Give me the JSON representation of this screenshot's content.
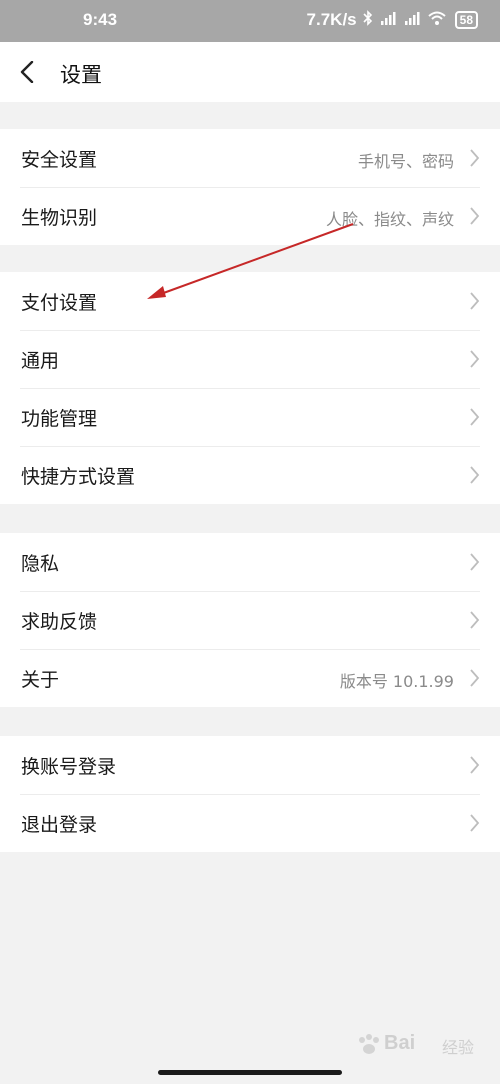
{
  "status_bar": {
    "time": "9:43",
    "speed": "7.7K/s",
    "battery": "58"
  },
  "header": {
    "title": "设置"
  },
  "sections": [
    [
      {
        "label": "安全设置",
        "value": "手机号、密码"
      },
      {
        "label": "生物识别",
        "value": "人脸、指纹、声纹"
      }
    ],
    [
      {
        "label": "支付设置",
        "value": ""
      },
      {
        "label": "通用",
        "value": ""
      },
      {
        "label": "功能管理",
        "value": ""
      },
      {
        "label": "快捷方式设置",
        "value": ""
      }
    ],
    [
      {
        "label": "隐私",
        "value": ""
      },
      {
        "label": "求助反馈",
        "value": ""
      },
      {
        "label": "关于",
        "value": "版本号 10.1.99"
      }
    ],
    [
      {
        "label": "换账号登录",
        "value": ""
      },
      {
        "label": "退出登录",
        "value": ""
      }
    ]
  ],
  "watermark": {
    "brand": "Bai",
    "sub": "经验"
  },
  "colors": {
    "annotation_arrow": "#c62828"
  }
}
